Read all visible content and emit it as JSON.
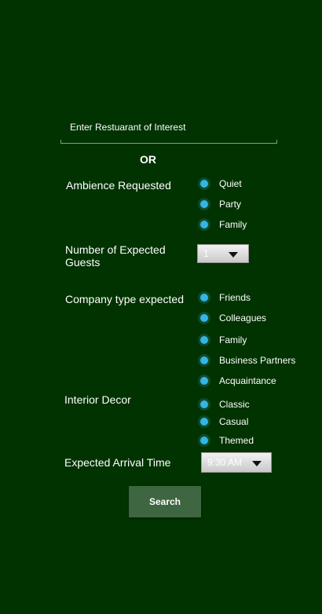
{
  "search": {
    "placeholder": "Enter Restuarant of Interest"
  },
  "or_label": "OR",
  "ambience": {
    "label": "Ambience Requested",
    "options": [
      "Quiet",
      "Party",
      "Family"
    ]
  },
  "guests": {
    "label": "Number of Expected Guests",
    "selected": "1"
  },
  "company": {
    "label": "Company type expected",
    "options": [
      "Friends",
      "Colleagues",
      "Family",
      "Business Partners",
      "Acquaintance"
    ]
  },
  "decor": {
    "label": "Interior Decor",
    "options": [
      "Classic",
      "Casual",
      "Themed"
    ]
  },
  "arrival": {
    "label": "Expected Arrival Time",
    "selected": "9:30 AM"
  },
  "search_button": {
    "label": "Search"
  },
  "colors": {
    "background": "#003300",
    "radio_accent": "#33b5e5",
    "button": "#3e6640"
  },
  "icons": {
    "dropdown": "chevron-down-icon"
  }
}
